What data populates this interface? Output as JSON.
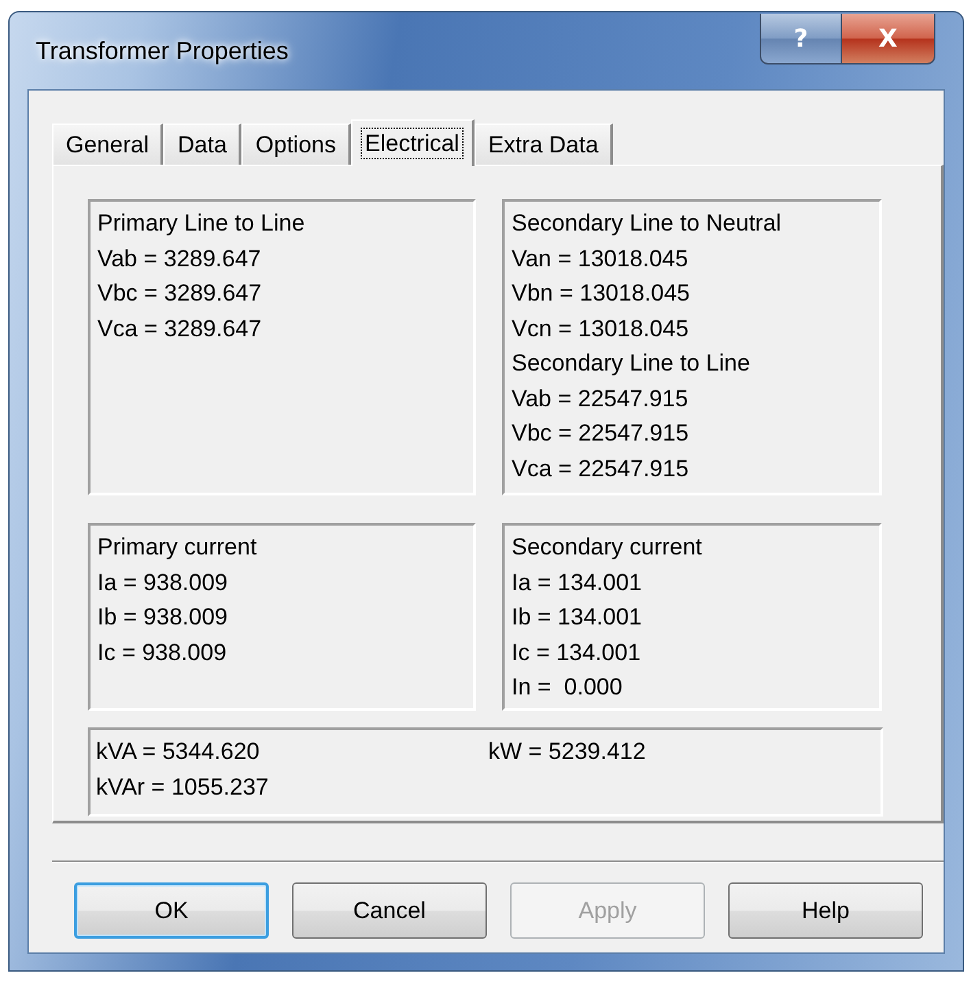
{
  "window": {
    "title": "Transformer Properties"
  },
  "title_buttons": [
    {
      "kind": "help",
      "label": "?"
    },
    {
      "kind": "close",
      "label": "X"
    }
  ],
  "tabs": [
    {
      "label": "General",
      "selected": false
    },
    {
      "label": "Data",
      "selected": false
    },
    {
      "label": "Options",
      "selected": false
    },
    {
      "label": "Electrical",
      "selected": true
    },
    {
      "label": "Extra Data",
      "selected": false
    }
  ],
  "boxes": [
    {
      "lines": [
        "Primary Line to Line",
        "Vab = 3289.647",
        "Vbc = 3289.647",
        "Vca = 3289.647"
      ]
    },
    {
      "lines": [
        "Secondary Line to Neutral",
        "Van = 13018.045",
        "Vbn = 13018.045",
        "Vcn = 13018.045",
        "Secondary Line to Line",
        "Vab = 22547.915",
        "Vbc = 22547.915",
        "Vca = 22547.915"
      ]
    },
    {
      "lines": [
        "Primary current",
        "Ia = 938.009",
        "Ib = 938.009",
        "Ic = 938.009"
      ]
    },
    {
      "lines": [
        "Secondary current",
        "Ia = 134.001",
        "Ib = 134.001",
        "Ic = 134.001",
        "In =  0.000"
      ]
    }
  ],
  "power_box": {
    "column_1": [
      "kVA = 5344.620",
      "kVAr = 1055.237"
    ],
    "column_2": [
      "kW = 5239.412"
    ]
  },
  "buttons": [
    {
      "label": "OK",
      "default": true,
      "disabled": false
    },
    {
      "label": "Cancel",
      "default": false,
      "disabled": false
    },
    {
      "label": "Apply",
      "default": false,
      "disabled": true
    },
    {
      "label": "Help",
      "default": false,
      "disabled": false
    }
  ]
}
